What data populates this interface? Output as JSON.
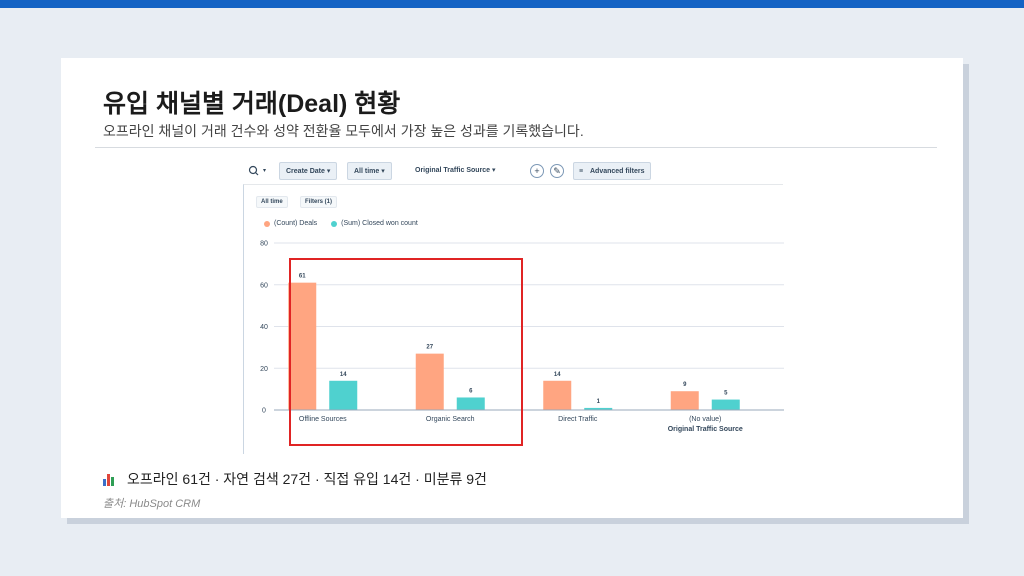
{
  "slide": {
    "title": "유입 채널별 거래(Deal) 현황",
    "subtitle": "오프라인 채널이 거래 건수와 성약 전환율 모두에서 가장 높은 성과를 기록했습니다.",
    "caption_icon": "bar-chart-icon",
    "caption": "오프라인 61건 · 자연 검색 27건 · 직접 유입 14건 · 미분류 9건",
    "source": "출처: HubSpot CRM",
    "accent_color": "#1463c4"
  },
  "toolbar": {
    "search_icon": "search-icon",
    "create_date_label": "Create Date ▾",
    "all_time_label": "All time ▾",
    "traffic_source_label": "Original Traffic Source ▾",
    "add_label": "+",
    "edit_label": "✎",
    "advanced_filters_label": "Advanced filters"
  },
  "filters": {
    "all_time": "All time",
    "filters_count": "Filters (1)"
  },
  "chart_data": {
    "type": "bar",
    "categories": [
      "Offline Sources",
      "Organic Search",
      "Direct Traffic",
      "(No value)"
    ],
    "series": [
      {
        "name": "(Count) Deals",
        "values": [
          61,
          27,
          14,
          9
        ],
        "color": "#ffa581"
      },
      {
        "name": "(Sum) Closed won count",
        "values": [
          14,
          6,
          1,
          5
        ],
        "color": "#4fd1cf"
      }
    ],
    "xlabel": "Original Traffic Source",
    "ylabel": "",
    "ylim": [
      0,
      80
    ],
    "yticks": [
      0,
      20,
      40,
      60,
      80
    ],
    "grid": true,
    "legend": "top-left",
    "highlight_categories": [
      "Offline Sources",
      "Organic Search"
    ],
    "highlight_color": "#e02424"
  }
}
